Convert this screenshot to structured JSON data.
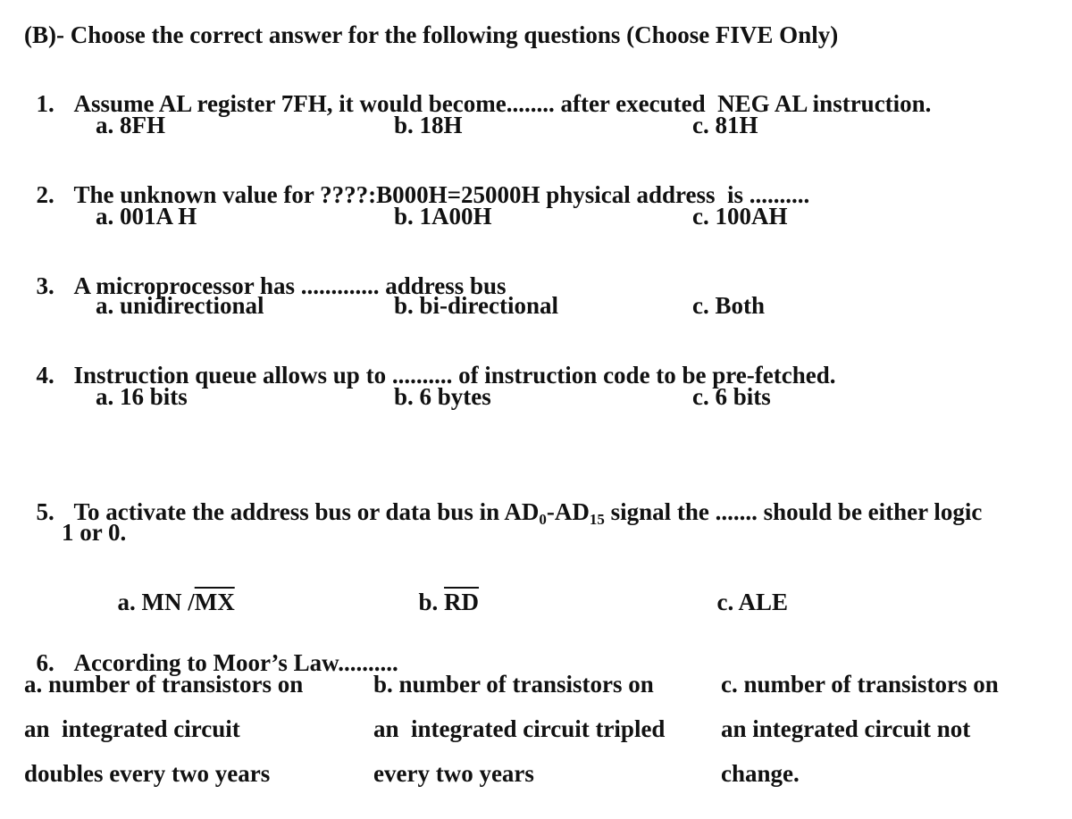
{
  "section": {
    "heading": "(B)- Choose the correct answer for the following questions (Choose FIVE Only)"
  },
  "questions": [
    {
      "number": "1.",
      "text": "Assume AL register 7FH, it would become........ after executed  NEG AL instruction.",
      "options": [
        "a. 8FH",
        "b. 18H",
        "c. 81H"
      ]
    },
    {
      "number": "2.",
      "text": "The unknown value for ????:B000H=25000H physical address  is ..........",
      "options": [
        "a. 001A H",
        "b. 1A00H",
        "c. 100AH"
      ]
    },
    {
      "number": "3.",
      "text": "A microprocessor has ............. address bus",
      "options": [
        "a. unidirectional",
        "b. bi-directional",
        "c. Both"
      ]
    },
    {
      "number": "4.",
      "text": "Instruction queue allows up to .......... of instruction code to be pre-fetched.",
      "options": [
        "a. 16 bits",
        "b. 6 bytes",
        "c. 6 bits"
      ]
    },
    {
      "number": "5.",
      "text_before": "To activate the address bus or data bus in AD",
      "sub_0": "0",
      "text_mid": "-AD",
      "sub_15": "15",
      "text_after": " signal the ....... should be either logic",
      "text_line2": "1 or 0.",
      "options": [
        {
          "prefix": "a. MN /",
          "overlined": "MX"
        },
        {
          "prefix": "b. ",
          "overlined": "RD"
        },
        {
          "prefix": "c. ALE",
          "overlined": ""
        }
      ]
    },
    {
      "number": "6.",
      "text": "According to Moor’s Law..........",
      "options": [
        {
          "lines": [
            "a. number of transistors on",
            "an  integrated circuit",
            "doubles every two years"
          ]
        },
        {
          "lines": [
            "b. number of transistors on",
            "an  integrated circuit tripled",
            "every two years"
          ]
        },
        {
          "lines": [
            "c. number of transistors on",
            "an integrated circuit not",
            "change."
          ]
        }
      ]
    }
  ]
}
